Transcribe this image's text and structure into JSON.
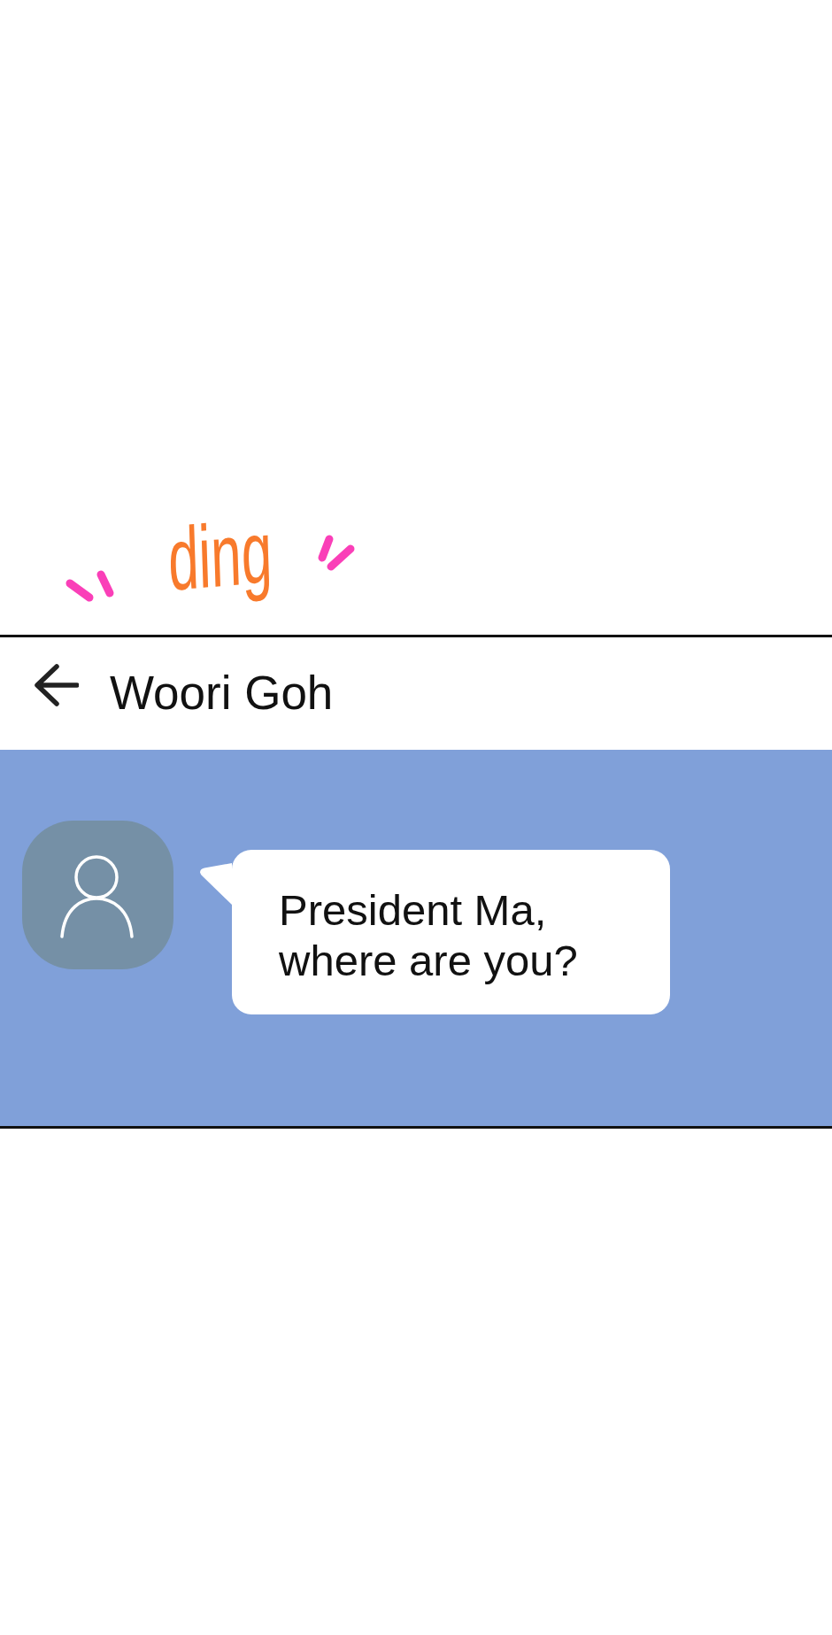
{
  "sound_effect": {
    "text": "ding"
  },
  "chat": {
    "contact_name": "Woori Goh",
    "messages": [
      {
        "text": "President Ma, where are you?"
      }
    ]
  }
}
